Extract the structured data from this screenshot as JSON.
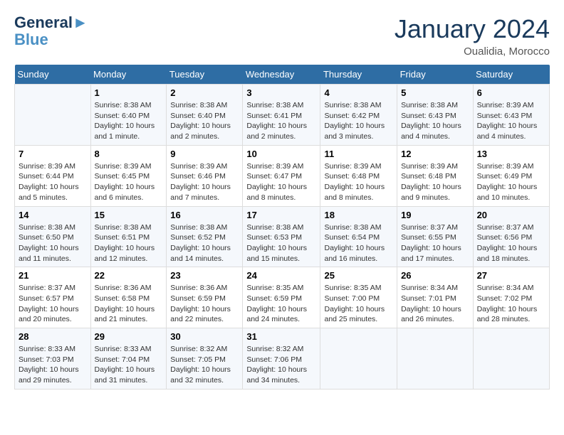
{
  "header": {
    "logo_line1": "General",
    "logo_line2": "Blue",
    "month_year": "January 2024",
    "location": "Oualidia, Morocco"
  },
  "days_of_week": [
    "Sunday",
    "Monday",
    "Tuesday",
    "Wednesday",
    "Thursday",
    "Friday",
    "Saturday"
  ],
  "weeks": [
    [
      {
        "day": "",
        "text": ""
      },
      {
        "day": "1",
        "text": "Sunrise: 8:38 AM\nSunset: 6:40 PM\nDaylight: 10 hours\nand 1 minute."
      },
      {
        "day": "2",
        "text": "Sunrise: 8:38 AM\nSunset: 6:40 PM\nDaylight: 10 hours\nand 2 minutes."
      },
      {
        "day": "3",
        "text": "Sunrise: 8:38 AM\nSunset: 6:41 PM\nDaylight: 10 hours\nand 2 minutes."
      },
      {
        "day": "4",
        "text": "Sunrise: 8:38 AM\nSunset: 6:42 PM\nDaylight: 10 hours\nand 3 minutes."
      },
      {
        "day": "5",
        "text": "Sunrise: 8:38 AM\nSunset: 6:43 PM\nDaylight: 10 hours\nand 4 minutes."
      },
      {
        "day": "6",
        "text": "Sunrise: 8:39 AM\nSunset: 6:43 PM\nDaylight: 10 hours\nand 4 minutes."
      }
    ],
    [
      {
        "day": "7",
        "text": "Sunrise: 8:39 AM\nSunset: 6:44 PM\nDaylight: 10 hours\nand 5 minutes."
      },
      {
        "day": "8",
        "text": "Sunrise: 8:39 AM\nSunset: 6:45 PM\nDaylight: 10 hours\nand 6 minutes."
      },
      {
        "day": "9",
        "text": "Sunrise: 8:39 AM\nSunset: 6:46 PM\nDaylight: 10 hours\nand 7 minutes."
      },
      {
        "day": "10",
        "text": "Sunrise: 8:39 AM\nSunset: 6:47 PM\nDaylight: 10 hours\nand 8 minutes."
      },
      {
        "day": "11",
        "text": "Sunrise: 8:39 AM\nSunset: 6:48 PM\nDaylight: 10 hours\nand 8 minutes."
      },
      {
        "day": "12",
        "text": "Sunrise: 8:39 AM\nSunset: 6:48 PM\nDaylight: 10 hours\nand 9 minutes."
      },
      {
        "day": "13",
        "text": "Sunrise: 8:39 AM\nSunset: 6:49 PM\nDaylight: 10 hours\nand 10 minutes."
      }
    ],
    [
      {
        "day": "14",
        "text": "Sunrise: 8:38 AM\nSunset: 6:50 PM\nDaylight: 10 hours\nand 11 minutes."
      },
      {
        "day": "15",
        "text": "Sunrise: 8:38 AM\nSunset: 6:51 PM\nDaylight: 10 hours\nand 12 minutes."
      },
      {
        "day": "16",
        "text": "Sunrise: 8:38 AM\nSunset: 6:52 PM\nDaylight: 10 hours\nand 14 minutes."
      },
      {
        "day": "17",
        "text": "Sunrise: 8:38 AM\nSunset: 6:53 PM\nDaylight: 10 hours\nand 15 minutes."
      },
      {
        "day": "18",
        "text": "Sunrise: 8:38 AM\nSunset: 6:54 PM\nDaylight: 10 hours\nand 16 minutes."
      },
      {
        "day": "19",
        "text": "Sunrise: 8:37 AM\nSunset: 6:55 PM\nDaylight: 10 hours\nand 17 minutes."
      },
      {
        "day": "20",
        "text": "Sunrise: 8:37 AM\nSunset: 6:56 PM\nDaylight: 10 hours\nand 18 minutes."
      }
    ],
    [
      {
        "day": "21",
        "text": "Sunrise: 8:37 AM\nSunset: 6:57 PM\nDaylight: 10 hours\nand 20 minutes."
      },
      {
        "day": "22",
        "text": "Sunrise: 8:36 AM\nSunset: 6:58 PM\nDaylight: 10 hours\nand 21 minutes."
      },
      {
        "day": "23",
        "text": "Sunrise: 8:36 AM\nSunset: 6:59 PM\nDaylight: 10 hours\nand 22 minutes."
      },
      {
        "day": "24",
        "text": "Sunrise: 8:35 AM\nSunset: 6:59 PM\nDaylight: 10 hours\nand 24 minutes."
      },
      {
        "day": "25",
        "text": "Sunrise: 8:35 AM\nSunset: 7:00 PM\nDaylight: 10 hours\nand 25 minutes."
      },
      {
        "day": "26",
        "text": "Sunrise: 8:34 AM\nSunset: 7:01 PM\nDaylight: 10 hours\nand 26 minutes."
      },
      {
        "day": "27",
        "text": "Sunrise: 8:34 AM\nSunset: 7:02 PM\nDaylight: 10 hours\nand 28 minutes."
      }
    ],
    [
      {
        "day": "28",
        "text": "Sunrise: 8:33 AM\nSunset: 7:03 PM\nDaylight: 10 hours\nand 29 minutes."
      },
      {
        "day": "29",
        "text": "Sunrise: 8:33 AM\nSunset: 7:04 PM\nDaylight: 10 hours\nand 31 minutes."
      },
      {
        "day": "30",
        "text": "Sunrise: 8:32 AM\nSunset: 7:05 PM\nDaylight: 10 hours\nand 32 minutes."
      },
      {
        "day": "31",
        "text": "Sunrise: 8:32 AM\nSunset: 7:06 PM\nDaylight: 10 hours\nand 34 minutes."
      },
      {
        "day": "",
        "text": ""
      },
      {
        "day": "",
        "text": ""
      },
      {
        "day": "",
        "text": ""
      }
    ]
  ]
}
